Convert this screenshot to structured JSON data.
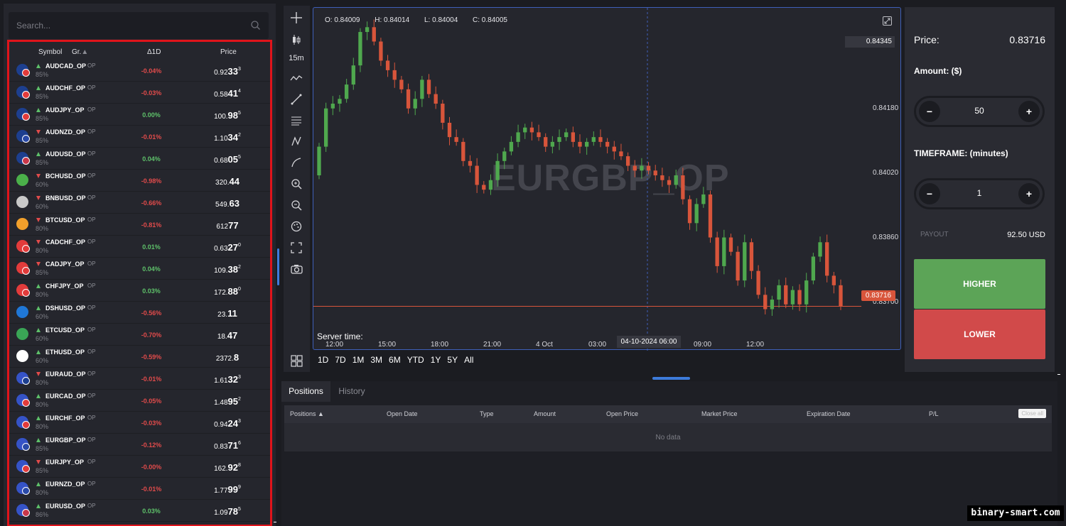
{
  "search": {
    "placeholder": "Search..."
  },
  "list_header": {
    "symbol": "Symbol",
    "group": "Gr.",
    "change": "Δ1D",
    "price": "Price"
  },
  "assets": [
    {
      "symbol": "AUDCAD_OP",
      "tag": "OP",
      "payout": "85%",
      "dir": "up",
      "change": "-0.04%",
      "sign": "neg",
      "price_a": "0.92",
      "price_b": "33",
      "price_c": "3",
      "c1": "#1d3f8f",
      "c2": "#e23b3b"
    },
    {
      "symbol": "AUDCHF_OP",
      "tag": "OP",
      "payout": "85%",
      "dir": "up",
      "change": "-0.03%",
      "sign": "neg",
      "price_a": "0.58",
      "price_b": "41",
      "price_c": "4",
      "c1": "#1d3f8f",
      "c2": "#e23b3b"
    },
    {
      "symbol": "AUDJPY_OP",
      "tag": "OP",
      "payout": "85%",
      "dir": "up",
      "change": "0.00%",
      "sign": "pos",
      "price_a": "100.",
      "price_b": "98",
      "price_c": "5",
      "c1": "#1d3f8f",
      "c2": "#e23b3b"
    },
    {
      "symbol": "AUDNZD_OP",
      "tag": "OP",
      "payout": "85%",
      "dir": "down",
      "change": "-0.01%",
      "sign": "neg",
      "price_a": "1.10",
      "price_b": "34",
      "price_c": "2",
      "c1": "#1d3f8f",
      "c2": "#2a4aa8"
    },
    {
      "symbol": "AUDUSD_OP",
      "tag": "OP",
      "payout": "85%",
      "dir": "up",
      "change": "0.04%",
      "sign": "pos",
      "price_a": "0.68",
      "price_b": "05",
      "price_c": "5",
      "c1": "#1d3f8f",
      "c2": "#c9374a"
    },
    {
      "symbol": "BCHUSD_OP",
      "tag": "OP",
      "payout": "60%",
      "dir": "down",
      "change": "-0.98%",
      "sign": "neg",
      "price_a": "320.",
      "price_b": "44",
      "price_c": "",
      "c1": "#4bb04a",
      "c2": ""
    },
    {
      "symbol": "BNBUSD_OP",
      "tag": "OP",
      "payout": "60%",
      "dir": "down",
      "change": "-0.66%",
      "sign": "neg",
      "price_a": "549.",
      "price_b": "63",
      "price_c": "",
      "c1": "#c9c9c9",
      "c2": ""
    },
    {
      "symbol": "BTCUSD_OP",
      "tag": "OP",
      "payout": "80%",
      "dir": "down",
      "change": "-0.81%",
      "sign": "neg",
      "price_a": "612",
      "price_b": "77",
      "price_c": "",
      "c1": "#f2a02b",
      "c2": ""
    },
    {
      "symbol": "CADCHF_OP",
      "tag": "OP",
      "payout": "80%",
      "dir": "down",
      "change": "0.01%",
      "sign": "pos",
      "price_a": "0.63",
      "price_b": "27",
      "price_c": "0",
      "c1": "#e23b3b",
      "c2": "#e23b3b"
    },
    {
      "symbol": "CADJPY_OP",
      "tag": "OP",
      "payout": "85%",
      "dir": "down",
      "change": "0.04%",
      "sign": "pos",
      "price_a": "109.",
      "price_b": "38",
      "price_c": "2",
      "c1": "#e23b3b",
      "c2": "#e23b3b"
    },
    {
      "symbol": "CHFJPY_OP",
      "tag": "OP",
      "payout": "80%",
      "dir": "up",
      "change": "0.03%",
      "sign": "pos",
      "price_a": "172.",
      "price_b": "88",
      "price_c": "0",
      "c1": "#e23b3b",
      "c2": "#e23b3b"
    },
    {
      "symbol": "DSHUSD_OP",
      "tag": "OP",
      "payout": "60%",
      "dir": "up",
      "change": "-0.56%",
      "sign": "neg",
      "price_a": "23.",
      "price_b": "11",
      "price_c": "",
      "c1": "#1f77d6",
      "c2": ""
    },
    {
      "symbol": "ETCUSD_OP",
      "tag": "OP",
      "payout": "60%",
      "dir": "up",
      "change": "-0.70%",
      "sign": "neg",
      "price_a": "18.",
      "price_b": "47",
      "price_c": "",
      "c1": "#3aa556",
      "c2": ""
    },
    {
      "symbol": "ETHUSD_OP",
      "tag": "OP",
      "payout": "60%",
      "dir": "up",
      "change": "-0.59%",
      "sign": "neg",
      "price_a": "2372.",
      "price_b": "8",
      "price_c": "",
      "c1": "#ffffff",
      "c2": ""
    },
    {
      "symbol": "EURAUD_OP",
      "tag": "OP",
      "payout": "80%",
      "dir": "down",
      "change": "-0.01%",
      "sign": "neg",
      "price_a": "1.61",
      "price_b": "32",
      "price_c": "3",
      "c1": "#3553c7",
      "c2": "#1d3f8f"
    },
    {
      "symbol": "EURCAD_OP",
      "tag": "OP",
      "payout": "80%",
      "dir": "up",
      "change": "-0.05%",
      "sign": "neg",
      "price_a": "1.48",
      "price_b": "95",
      "price_c": "2",
      "c1": "#3553c7",
      "c2": "#e23b3b"
    },
    {
      "symbol": "EURCHF_OP",
      "tag": "OP",
      "payout": "80%",
      "dir": "up",
      "change": "-0.03%",
      "sign": "neg",
      "price_a": "0.94",
      "price_b": "24",
      "price_c": "3",
      "c1": "#3553c7",
      "c2": "#e23b3b"
    },
    {
      "symbol": "EURGBP_OP",
      "tag": "OP",
      "payout": "85%",
      "dir": "up",
      "change": "-0.12%",
      "sign": "neg",
      "price_a": "0.83",
      "price_b": "71",
      "price_c": "6",
      "c1": "#3553c7",
      "c2": "#2a4aa8"
    },
    {
      "symbol": "EURJPY_OP",
      "tag": "OP",
      "payout": "85%",
      "dir": "down",
      "change": "-0.00%",
      "sign": "neg",
      "price_a": "162.",
      "price_b": "92",
      "price_c": "8",
      "c1": "#3553c7",
      "c2": "#e23b3b"
    },
    {
      "symbol": "EURNZD_OP",
      "tag": "OP",
      "payout": "80%",
      "dir": "up",
      "change": "-0.01%",
      "sign": "neg",
      "price_a": "1.77",
      "price_b": "99",
      "price_c": "9",
      "c1": "#3553c7",
      "c2": "#2a4aa8"
    },
    {
      "symbol": "EURUSD_OP",
      "tag": "OP",
      "payout": "86%",
      "dir": "up",
      "change": "0.03%",
      "sign": "pos",
      "price_a": "1.09",
      "price_b": "78",
      "price_c": "5",
      "c1": "#3553c7",
      "c2": "#c9374a"
    }
  ],
  "toolbar": {
    "interval": "15m"
  },
  "chart": {
    "symbol": "EURGBP_OP",
    "ohlc": {
      "o": "O: 0.84009",
      "h": "H: 0.84014",
      "l": "L: 0.84004",
      "c": "C: 0.84005"
    },
    "crosshair_price": "0.84345",
    "current_price_tag": "0.83716",
    "crosshair_time": "04-10-2024 06:00",
    "server_time_label": "Server time:",
    "y_ticks": [
      "0.84180",
      "0.84020",
      "0.83860",
      "0.83700"
    ],
    "x_ticks": [
      "12:00",
      "15:00",
      "18:00",
      "21:00",
      "4 Oct",
      "03:00",
      "09:00",
      "12:00"
    ],
    "ranges": [
      "1D",
      "7D",
      "1M",
      "3M",
      "6M",
      "YTD",
      "1Y",
      "5Y",
      "All"
    ],
    "colors": {
      "up": "#4fa84e",
      "down": "#d8553b",
      "crosshair": "#3e5fb8"
    }
  },
  "chart_data": {
    "type": "candlestick",
    "symbol": "EURGBP_OP",
    "interval": "15m",
    "title": "EURGBP_OP",
    "x_ticks": [
      "12:00",
      "15:00",
      "18:00",
      "21:00",
      "4 Oct",
      "03:00",
      "09:00",
      "12:00"
    ],
    "y_ticks": [
      0.8418,
      0.8402,
      0.8386,
      0.837
    ],
    "ylim": [
      0.83687,
      0.84296
    ],
    "last_price": 0.83716,
    "crosshair": {
      "price": 0.84345,
      "time": "04-10-2024 06:00"
    },
    "ohlc_readout": {
      "open": 0.84009,
      "high": 0.84014,
      "low": 0.84004,
      "close": 0.84005
    },
    "close": [
      0.8405,
      0.8413,
      0.8414,
      0.8415,
      0.8418,
      0.8422,
      0.8429,
      0.843,
      0.8427,
      0.8423,
      0.8421,
      0.8419,
      0.8417,
      0.8413,
      0.8415,
      0.8419,
      0.8416,
      0.8414,
      0.841,
      0.8407,
      0.8406,
      0.8402,
      0.8401,
      0.8397,
      0.8396,
      0.8398,
      0.8402,
      0.8404,
      0.8406,
      0.8408,
      0.8409,
      0.8408,
      0.8407,
      0.8405,
      0.8406,
      0.8407,
      0.8408,
      0.8406,
      0.8405,
      0.8406,
      0.8407,
      0.8406,
      0.8405,
      0.8404,
      0.8403,
      0.8401,
      0.84,
      0.8401,
      0.84,
      0.8399,
      0.8398,
      0.8397,
      0.8399,
      0.8394,
      0.8389,
      0.8393,
      0.8395,
      0.8386,
      0.838,
      0.8386,
      0.8383,
      0.8377,
      0.8385,
      0.8379,
      0.8374,
      0.8371,
      0.8373,
      0.8376,
      0.8372,
      0.8375,
      0.8372,
      0.8377,
      0.8382,
      0.8385,
      0.8378,
      0.8376,
      0.83716
    ]
  },
  "trade": {
    "price_label": "Price:",
    "price_value": "0.83716",
    "amount_label": "Amount: ($)",
    "amount_value": "50",
    "timeframe_label": "TIMEFRAME: (minutes)",
    "timeframe_value": "1",
    "minus": "−",
    "plus": "+",
    "payout_label": "PAYOUT",
    "payout_value": "92.50 USD",
    "higher": "HIGHER",
    "lower": "LOWER"
  },
  "positions": {
    "tabs": [
      "Positions",
      "History"
    ],
    "columns": [
      "Positions ▲",
      "Open Date",
      "Type",
      "Amount",
      "Open Price",
      "Market Price",
      "Expiration Date",
      "P/L"
    ],
    "close_all": "Close all",
    "empty": "No data"
  },
  "watermark": "binary-smart.com"
}
